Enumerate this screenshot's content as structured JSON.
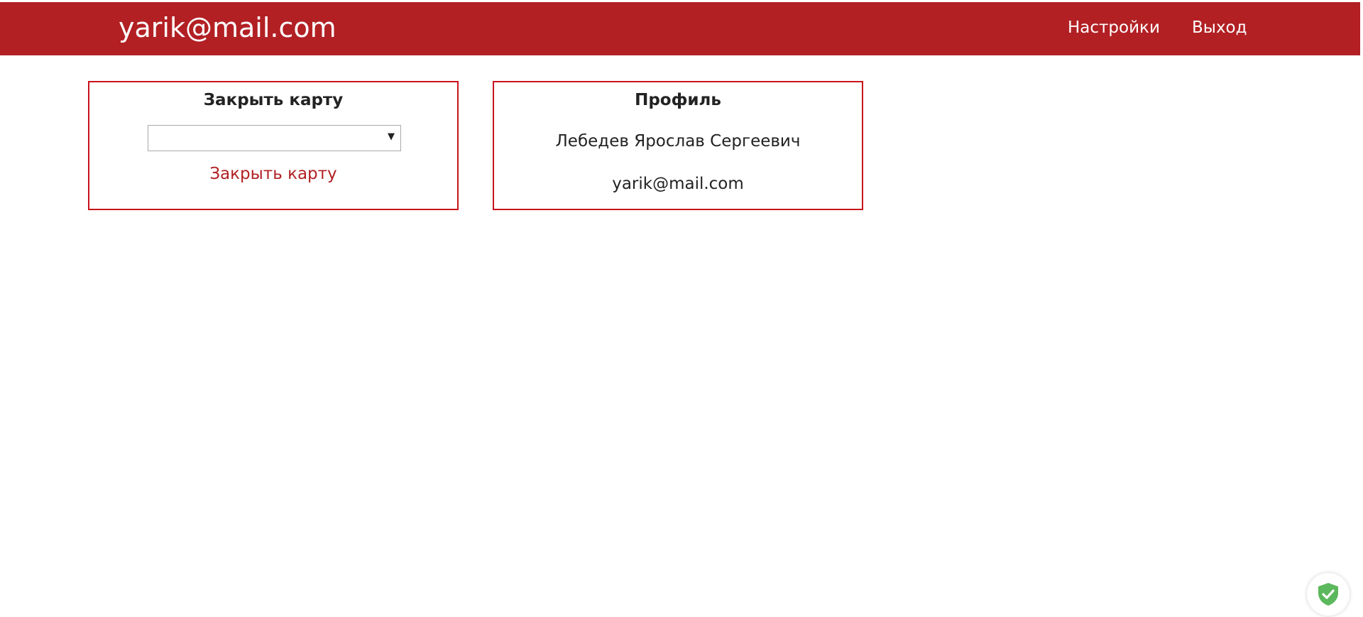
{
  "header": {
    "brand": "yarik@mail.com",
    "nav": {
      "settings": "Настройки",
      "logout": "Выход"
    }
  },
  "close_card": {
    "title": "Закрыть карту",
    "select": {
      "selected_value": "",
      "arrow_icon": "triangle-down-icon"
    },
    "action_label": "Закрыть карту"
  },
  "profile_card": {
    "title": "Профиль",
    "full_name": "Лебедев Ярослав Сергеевич",
    "email": "yarik@mail.com"
  },
  "widgets": {
    "shield_icon": "shield-check-icon"
  },
  "colors": {
    "header_bg": "#b22024",
    "card_border": "#c8141c",
    "link": "#b22024",
    "shield": "#5cb85c"
  }
}
